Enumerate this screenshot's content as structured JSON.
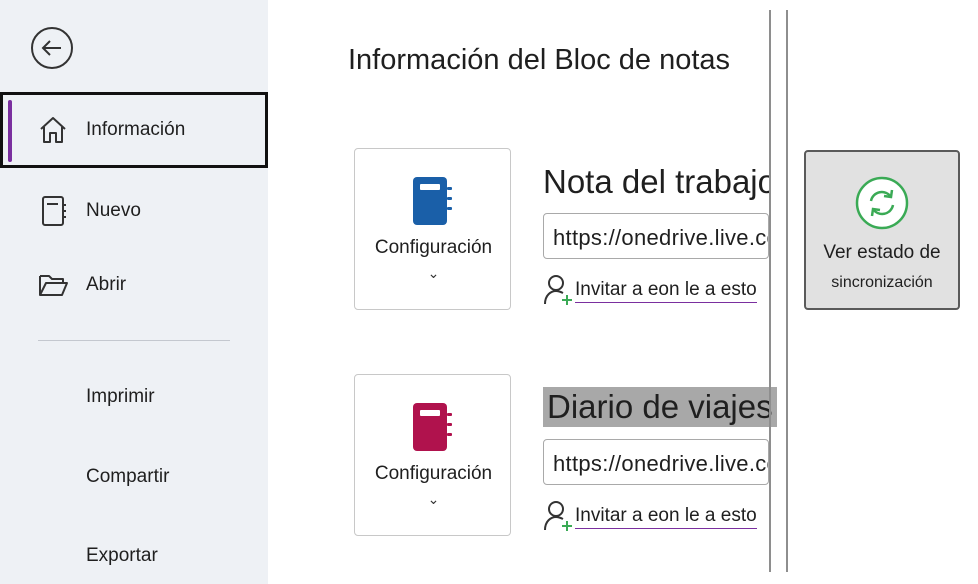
{
  "sidebar": {
    "items": [
      {
        "label": "Información"
      },
      {
        "label": "Nuevo"
      },
      {
        "label": "Abrir"
      },
      {
        "label": "Imprimir"
      },
      {
        "label": "Compartir"
      },
      {
        "label": "Exportar"
      }
    ]
  },
  "main": {
    "title": "Información del Bloc de notas",
    "notebooks": [
      {
        "name": "Nota del trabajo",
        "settings_label": "Configuración",
        "url": "https://onedrive.live.com",
        "invite": "Invitar a eon le a esto",
        "color": "#1a5fa8"
      },
      {
        "name": "Diario de viajes",
        "settings_label": "Configuración",
        "url": "https://onedrive.live.com",
        "invite": "Invitar a eon le a esto",
        "color": "#b0124d"
      }
    ],
    "sync": {
      "line1": "Ver estado de",
      "line2": "sincronización",
      "color": "#3aaa55"
    }
  },
  "icons": {
    "back": "back-arrow-icon",
    "home": "home-icon",
    "new": "notebook-new-icon",
    "open": "folder-open-icon",
    "person_add": "person-add-icon",
    "sync": "sync-icon",
    "chevron": "chevron-down-icon"
  }
}
